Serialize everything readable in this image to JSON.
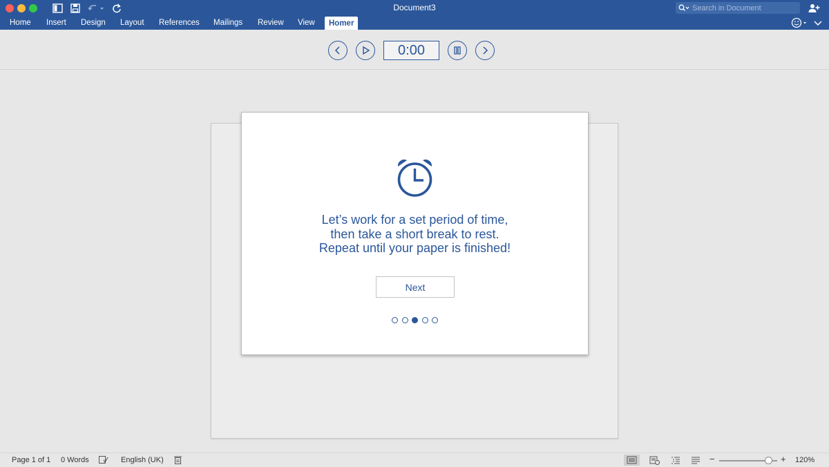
{
  "window": {
    "title": "Document3",
    "search_placeholder": "Search in Document"
  },
  "ribbon": {
    "tabs": [
      "Home",
      "Insert",
      "Design",
      "Layout",
      "References",
      "Mailings",
      "Review",
      "View",
      "Homer"
    ],
    "active_tab": "Homer"
  },
  "timer": {
    "display": "0:00"
  },
  "dialog": {
    "message_lines": [
      "Let’s work for a set period of time,",
      "then take a short break to rest.",
      "Repeat until your paper is finished!"
    ],
    "next_label": "Next",
    "pager_total": 5,
    "pager_current": 3
  },
  "statusbar": {
    "page": "Page 1 of 1",
    "words": "0 Words",
    "language": "English (UK)",
    "zoom": "120%"
  },
  "colors": {
    "brand": "#2b579a",
    "close": "#fc605c",
    "minimize": "#fdbc40",
    "maximize": "#34c84a"
  },
  "icons": [
    "sidebar-icon",
    "save-icon",
    "undo-icon",
    "redo-icon",
    "search-icon",
    "share-icon",
    "smiley-icon",
    "chevron-down-icon",
    "back-icon",
    "play-icon",
    "pause-icon",
    "forward-icon",
    "alarm-clock-icon",
    "proofing-icon",
    "macro-icon",
    "print-layout-icon",
    "web-layout-icon",
    "outline-icon",
    "draft-icon"
  ]
}
